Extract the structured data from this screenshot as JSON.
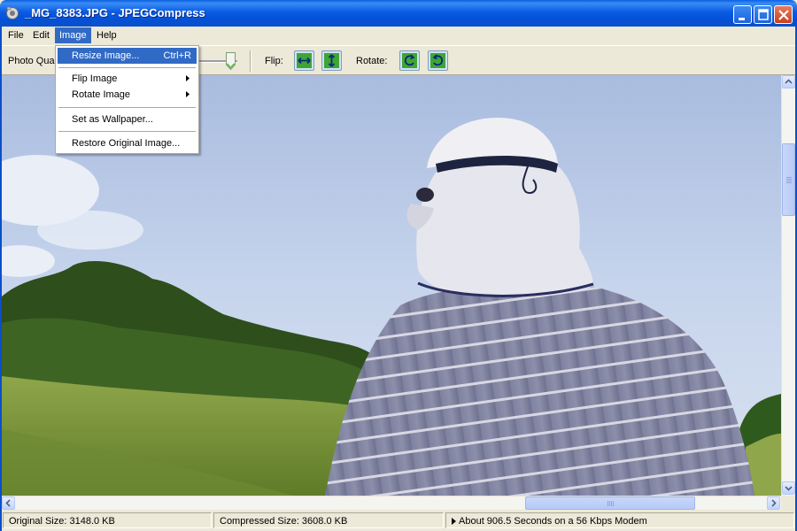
{
  "window": {
    "title": "_MG_8383.JPG - JPEGCompress",
    "buttons": {
      "minimize": "minimize",
      "maximize": "maximize",
      "close": "close"
    }
  },
  "menubar": {
    "file": "File",
    "edit": "Edit",
    "image": "Image",
    "help": "Help"
  },
  "toolbar": {
    "quality_label": "Photo Quality",
    "quality_level": 1.0,
    "flip_label": "Flip:",
    "rotate_label": "Rotate:",
    "icons": [
      "flip-horizontal-icon",
      "flip-vertical-icon",
      "rotate-counterclockwise-icon",
      "rotate-clockwise-icon"
    ]
  },
  "image_menu": {
    "items": [
      {
        "label": "Resize Image...",
        "shortcut": "Ctrl+R",
        "highlighted": true
      },
      {
        "label": "Flip Image",
        "submenu": true
      },
      {
        "label": "Rotate Image",
        "submenu": true
      },
      {
        "label": "Set as Wallpaper..."
      },
      {
        "label": "Restore Original Image..."
      }
    ]
  },
  "photo": {
    "subject": "person in white cap and hood, striped shirt, facing green hill under blue sky"
  },
  "statusbar": {
    "original_size": "Original Size: 3148.0 KB",
    "compressed_size": "Compressed Size: 3608.0 KB",
    "modem_time": "About 906.5 Seconds on a 56 Kbps Modem"
  },
  "colors": {
    "titlebar": "#0A5BE3",
    "menu_highlight": "#316AC5",
    "chrome": "#ECE9D8"
  }
}
